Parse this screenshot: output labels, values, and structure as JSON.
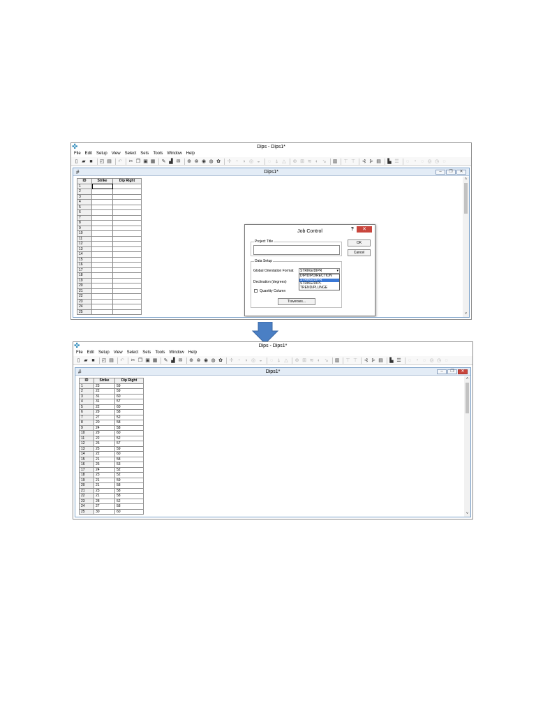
{
  "app": {
    "title": "Dips - Dips1*",
    "menu": [
      "File",
      "Edit",
      "Setup",
      "View",
      "Select",
      "Sets",
      "Tools",
      "Window",
      "Help"
    ]
  },
  "document": {
    "title": "Dips1*"
  },
  "grid": {
    "columns": [
      "ID",
      "Strike",
      "Dip Right"
    ],
    "row_ids": [
      "1",
      "2",
      "3",
      "4",
      "5",
      "6",
      "7",
      "8",
      "9",
      "10",
      "11",
      "12",
      "13",
      "14",
      "15",
      "16",
      "17",
      "18",
      "19",
      "20",
      "21",
      "22",
      "23",
      "24",
      "25"
    ],
    "filled_rows": [
      [
        "1",
        "23",
        "59"
      ],
      [
        "2",
        "22",
        "59"
      ],
      [
        "3",
        "31",
        "60"
      ],
      [
        "4",
        "31",
        "57"
      ],
      [
        "5",
        "22",
        "60"
      ],
      [
        "6",
        "29",
        "58"
      ],
      [
        "7",
        "27",
        "52"
      ],
      [
        "8",
        "20",
        "58"
      ],
      [
        "9",
        "24",
        "58"
      ],
      [
        "10",
        "29",
        "60"
      ],
      [
        "11",
        "22",
        "52"
      ],
      [
        "12",
        "26",
        "57"
      ],
      [
        "13",
        "25",
        "59"
      ],
      [
        "14",
        "22",
        "60"
      ],
      [
        "15",
        "21",
        "58"
      ],
      [
        "16",
        "26",
        "53"
      ],
      [
        "17",
        "24",
        "52"
      ],
      [
        "18",
        "23",
        "52"
      ],
      [
        "19",
        "21",
        "59"
      ],
      [
        "20",
        "21",
        "58"
      ],
      [
        "21",
        "23",
        "58"
      ],
      [
        "22",
        "21",
        "58"
      ],
      [
        "23",
        "28",
        "52"
      ],
      [
        "24",
        "27",
        "58"
      ],
      [
        "25",
        "30",
        "60"
      ]
    ]
  },
  "dialog": {
    "title": "Job Control",
    "help": "?",
    "close": "✕",
    "project_title_label": "Project Title",
    "ok_label": "OK",
    "cancel_label": "Cancel",
    "data_setup_label": "Data Setup",
    "orientation_label": "Global Orientation Format",
    "orientation_value": "STRIKE/DIPR",
    "orientation_options": [
      "DIP/DIPDIRECTION",
      "STRIKE/DIPR",
      "STRIKE/DIPL",
      "TREND/PLUNGE"
    ],
    "declination_label": "Declination (degrees)",
    "quantity_label": "Quantity Column",
    "traverses_label": "Traverses..."
  },
  "colors": {
    "accent": "#3a78d6",
    "close_red": "#c9463d",
    "arrow_blue": "#4a7fc4"
  }
}
